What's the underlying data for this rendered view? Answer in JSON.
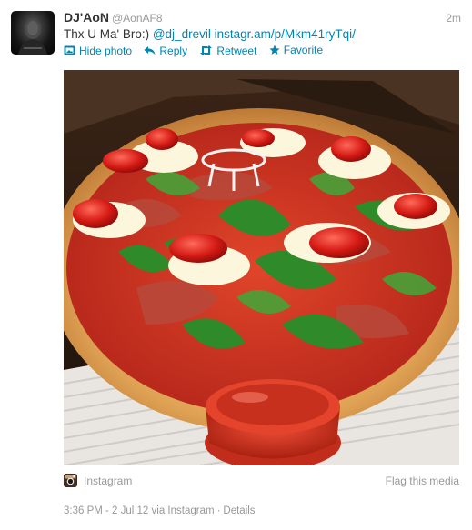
{
  "tweet": {
    "fullname": "DJ'AoN",
    "username": "@AonAF8",
    "timestamp": "2m",
    "text_prefix": "Thx U Ma' Bro:) ",
    "mention": "@dj_drevil",
    "url": "instagr.am/p/Mkm41ryTqi/"
  },
  "actions": {
    "hide_photo": "Hide photo",
    "reply": "Reply",
    "retweet": "Retweet",
    "favorite": "Favorite"
  },
  "media": {
    "source": "Instagram",
    "flag": "Flag this media"
  },
  "metadata": {
    "datetime": "3:36 PM - 2 Jul 12 via Instagram",
    "separator": "·",
    "details": "Details"
  },
  "icons": {
    "avatar": "avatar-image",
    "hide_photo": "photo-icon",
    "reply": "reply-arrow-icon",
    "retweet": "retweet-icon",
    "favorite": "star-icon",
    "instagram": "instagram-icon"
  },
  "colors": {
    "link": "#0084b4",
    "muted": "#999999",
    "text": "#333333"
  }
}
